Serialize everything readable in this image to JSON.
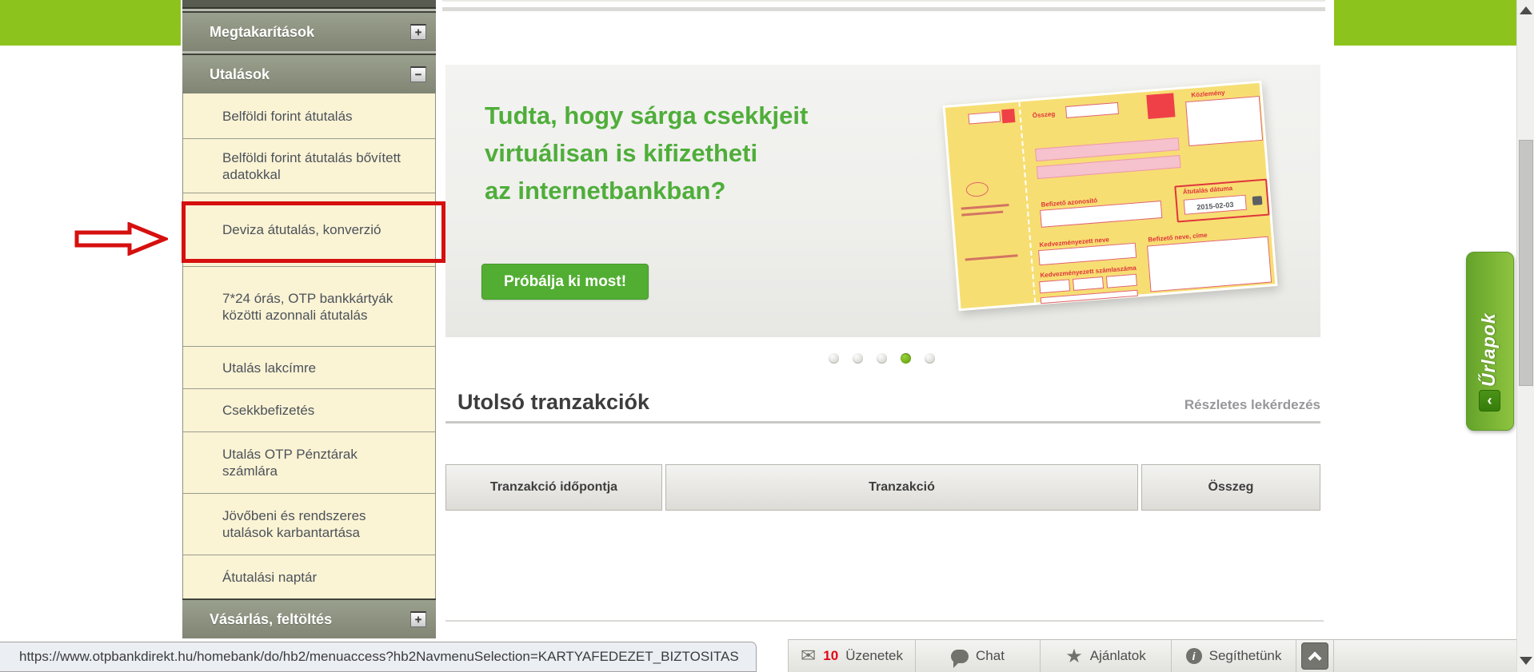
{
  "colors": {
    "topbar_green": "#8dc31d",
    "accent_green": "#52ae32",
    "headline_green": "#4fae3a",
    "sidebar_header_gray": "#8e9284",
    "sidebar_item_cream": "#faf3d4",
    "annotation_red": "#d60f0f",
    "badge_red": "#e30613"
  },
  "sidebar": {
    "groups": [
      {
        "label": "Megtakarítások",
        "toggle": "+"
      },
      {
        "label": "Utalások",
        "toggle": "−"
      },
      {
        "label": "Vásárlás, feltöltés",
        "toggle": "+"
      }
    ],
    "utalasok_items": [
      {
        "label": "Belföldi forint átutalás"
      },
      {
        "label": "Belföldi forint átutalás bővített adatokkal"
      },
      {
        "label": "Deviza átutalás, konverzió",
        "highlighted": true
      },
      {
        "label": "7*24 órás, OTP bankkártyák közötti azonnali átutalás"
      },
      {
        "label": "Utalás lakcímre"
      },
      {
        "label": "Csekkbefizetés"
      },
      {
        "label": "Utalás OTP Pénztárak számlára"
      },
      {
        "label": "Jövőbeni és rendszeres utalások karbantartása"
      },
      {
        "label": "Átutalási naptár"
      }
    ]
  },
  "banner": {
    "headline_lines": [
      "Tudta, hogy sárga csekkjeit",
      "virtuálisan is kifizetheti",
      "az internetbankban?"
    ],
    "cta_label": "Próbálja ki most!",
    "check": {
      "osszeg": "Összeg",
      "kozlemeny": "Közlemény",
      "befizeto_azonosito": "Befizető azonosító",
      "atutalas_datuma": "Átutalás dátuma",
      "datum": "2015-02-03",
      "kedvezmenyezett_neve": "Kedvezményezett neve",
      "kedvezmenyezett_szamlaszama": "Kedvezményezett számlaszáma",
      "befizeto_neve_cime": "Befizető neve, címe"
    }
  },
  "carousel": {
    "dot_count": 5,
    "active_index": 3
  },
  "transactions": {
    "title": "Utolsó tranzakciók",
    "link_label": "Részletes lekérdezés",
    "columns": [
      "Tranzakció időpontja",
      "Tranzakció",
      "Összeg"
    ],
    "rows": []
  },
  "forms_tab": {
    "label": "Űrlapok",
    "collapse_glyph": "‹"
  },
  "toolbar": {
    "messages_badge": "10",
    "messages_label": "Üzenetek",
    "chat_label": "Chat",
    "offers_label": "Ajánlatok",
    "help_label": "Segíthetünk"
  },
  "icons": {
    "envelope": "✉",
    "star": "★",
    "info": "i"
  },
  "browser": {
    "status_url": "https://www.otpbankdirekt.hu/homebank/do/hb2/menuaccess?hb2NavmenuSelection=KARTYAFEDEZET_BIZTOSITAS"
  }
}
